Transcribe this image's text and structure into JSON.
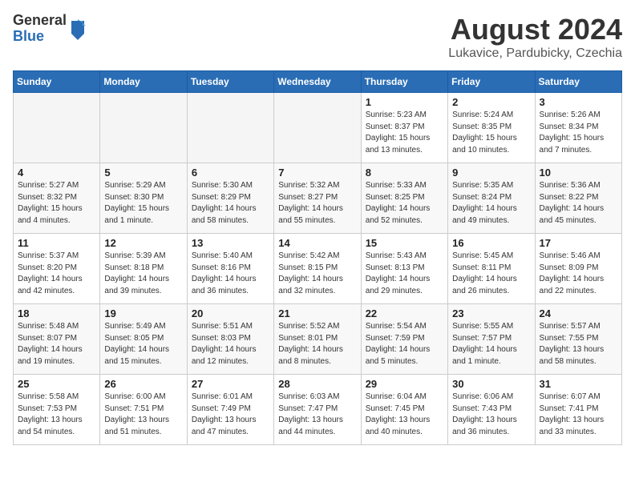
{
  "logo": {
    "general": "General",
    "blue": "Blue"
  },
  "title": {
    "month_year": "August 2024",
    "location": "Lukavice, Pardubicky, Czechia"
  },
  "days_of_week": [
    "Sunday",
    "Monday",
    "Tuesday",
    "Wednesday",
    "Thursday",
    "Friday",
    "Saturday"
  ],
  "weeks": [
    [
      {
        "day": "",
        "info": ""
      },
      {
        "day": "",
        "info": ""
      },
      {
        "day": "",
        "info": ""
      },
      {
        "day": "",
        "info": ""
      },
      {
        "day": "1",
        "info": "Sunrise: 5:23 AM\nSunset: 8:37 PM\nDaylight: 15 hours\nand 13 minutes."
      },
      {
        "day": "2",
        "info": "Sunrise: 5:24 AM\nSunset: 8:35 PM\nDaylight: 15 hours\nand 10 minutes."
      },
      {
        "day": "3",
        "info": "Sunrise: 5:26 AM\nSunset: 8:34 PM\nDaylight: 15 hours\nand 7 minutes."
      }
    ],
    [
      {
        "day": "4",
        "info": "Sunrise: 5:27 AM\nSunset: 8:32 PM\nDaylight: 15 hours\nand 4 minutes."
      },
      {
        "day": "5",
        "info": "Sunrise: 5:29 AM\nSunset: 8:30 PM\nDaylight: 15 hours\nand 1 minute."
      },
      {
        "day": "6",
        "info": "Sunrise: 5:30 AM\nSunset: 8:29 PM\nDaylight: 14 hours\nand 58 minutes."
      },
      {
        "day": "7",
        "info": "Sunrise: 5:32 AM\nSunset: 8:27 PM\nDaylight: 14 hours\nand 55 minutes."
      },
      {
        "day": "8",
        "info": "Sunrise: 5:33 AM\nSunset: 8:25 PM\nDaylight: 14 hours\nand 52 minutes."
      },
      {
        "day": "9",
        "info": "Sunrise: 5:35 AM\nSunset: 8:24 PM\nDaylight: 14 hours\nand 49 minutes."
      },
      {
        "day": "10",
        "info": "Sunrise: 5:36 AM\nSunset: 8:22 PM\nDaylight: 14 hours\nand 45 minutes."
      }
    ],
    [
      {
        "day": "11",
        "info": "Sunrise: 5:37 AM\nSunset: 8:20 PM\nDaylight: 14 hours\nand 42 minutes."
      },
      {
        "day": "12",
        "info": "Sunrise: 5:39 AM\nSunset: 8:18 PM\nDaylight: 14 hours\nand 39 minutes."
      },
      {
        "day": "13",
        "info": "Sunrise: 5:40 AM\nSunset: 8:16 PM\nDaylight: 14 hours\nand 36 minutes."
      },
      {
        "day": "14",
        "info": "Sunrise: 5:42 AM\nSunset: 8:15 PM\nDaylight: 14 hours\nand 32 minutes."
      },
      {
        "day": "15",
        "info": "Sunrise: 5:43 AM\nSunset: 8:13 PM\nDaylight: 14 hours\nand 29 minutes."
      },
      {
        "day": "16",
        "info": "Sunrise: 5:45 AM\nSunset: 8:11 PM\nDaylight: 14 hours\nand 26 minutes."
      },
      {
        "day": "17",
        "info": "Sunrise: 5:46 AM\nSunset: 8:09 PM\nDaylight: 14 hours\nand 22 minutes."
      }
    ],
    [
      {
        "day": "18",
        "info": "Sunrise: 5:48 AM\nSunset: 8:07 PM\nDaylight: 14 hours\nand 19 minutes."
      },
      {
        "day": "19",
        "info": "Sunrise: 5:49 AM\nSunset: 8:05 PM\nDaylight: 14 hours\nand 15 minutes."
      },
      {
        "day": "20",
        "info": "Sunrise: 5:51 AM\nSunset: 8:03 PM\nDaylight: 14 hours\nand 12 minutes."
      },
      {
        "day": "21",
        "info": "Sunrise: 5:52 AM\nSunset: 8:01 PM\nDaylight: 14 hours\nand 8 minutes."
      },
      {
        "day": "22",
        "info": "Sunrise: 5:54 AM\nSunset: 7:59 PM\nDaylight: 14 hours\nand 5 minutes."
      },
      {
        "day": "23",
        "info": "Sunrise: 5:55 AM\nSunset: 7:57 PM\nDaylight: 14 hours\nand 1 minute."
      },
      {
        "day": "24",
        "info": "Sunrise: 5:57 AM\nSunset: 7:55 PM\nDaylight: 13 hours\nand 58 minutes."
      }
    ],
    [
      {
        "day": "25",
        "info": "Sunrise: 5:58 AM\nSunset: 7:53 PM\nDaylight: 13 hours\nand 54 minutes."
      },
      {
        "day": "26",
        "info": "Sunrise: 6:00 AM\nSunset: 7:51 PM\nDaylight: 13 hours\nand 51 minutes."
      },
      {
        "day": "27",
        "info": "Sunrise: 6:01 AM\nSunset: 7:49 PM\nDaylight: 13 hours\nand 47 minutes."
      },
      {
        "day": "28",
        "info": "Sunrise: 6:03 AM\nSunset: 7:47 PM\nDaylight: 13 hours\nand 44 minutes."
      },
      {
        "day": "29",
        "info": "Sunrise: 6:04 AM\nSunset: 7:45 PM\nDaylight: 13 hours\nand 40 minutes."
      },
      {
        "day": "30",
        "info": "Sunrise: 6:06 AM\nSunset: 7:43 PM\nDaylight: 13 hours\nand 36 minutes."
      },
      {
        "day": "31",
        "info": "Sunrise: 6:07 AM\nSunset: 7:41 PM\nDaylight: 13 hours\nand 33 minutes."
      }
    ]
  ]
}
